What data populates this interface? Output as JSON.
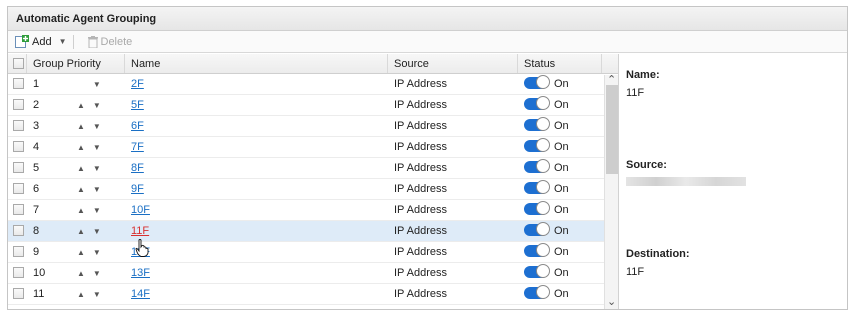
{
  "window": {
    "title": "Automatic Agent Grouping"
  },
  "toolbar": {
    "add_label": "Add",
    "delete_label": "Delete"
  },
  "columns": {
    "priority": "Group Priority",
    "name": "Name",
    "source": "Source",
    "status": "Status"
  },
  "rows": [
    {
      "priority": "1",
      "name": "2F",
      "source": "IP Address",
      "status": "On"
    },
    {
      "priority": "2",
      "name": "5F",
      "source": "IP Address",
      "status": "On"
    },
    {
      "priority": "3",
      "name": "6F",
      "source": "IP Address",
      "status": "On"
    },
    {
      "priority": "4",
      "name": "7F",
      "source": "IP Address",
      "status": "On"
    },
    {
      "priority": "5",
      "name": "8F",
      "source": "IP Address",
      "status": "On"
    },
    {
      "priority": "6",
      "name": "9F",
      "source": "IP Address",
      "status": "On"
    },
    {
      "priority": "7",
      "name": "10F",
      "source": "IP Address",
      "status": "On"
    },
    {
      "priority": "8",
      "name": "11F",
      "source": "IP Address",
      "status": "On"
    },
    {
      "priority": "9",
      "name": "12F",
      "source": "IP Address",
      "status": "On"
    },
    {
      "priority": "10",
      "name": "13F",
      "source": "IP Address",
      "status": "On"
    },
    {
      "priority": "11",
      "name": "14F",
      "source": "IP Address",
      "status": "On"
    }
  ],
  "detail": {
    "name_label": "Name:",
    "name_value": "11F",
    "source_label": "Source:",
    "destination_label": "Destination:",
    "destination_value": "11F"
  },
  "colors": {
    "accent": "#1d6fd1",
    "link": "#1a6fc4",
    "hover_row": "#deebf8",
    "active_link": "#d83030"
  }
}
